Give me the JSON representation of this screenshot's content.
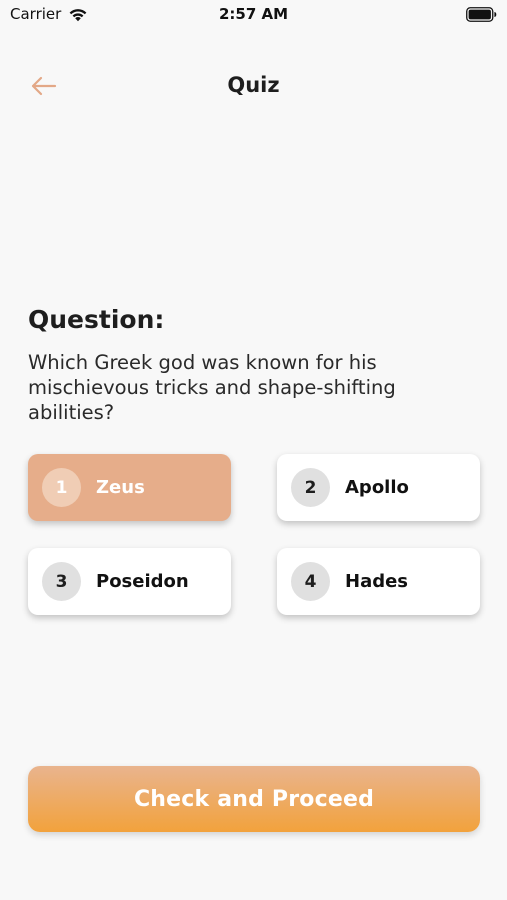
{
  "status_bar": {
    "carrier": "Carrier",
    "time": "2:57 AM",
    "wifi_icon": "wifi-icon",
    "battery_icon": "battery-icon"
  },
  "header": {
    "title": "Quiz",
    "back_icon": "arrow-left-icon",
    "accent_color": "#e3a887"
  },
  "question": {
    "heading": "Question:",
    "text": "Which Greek god was known for his mischievous tricks and shape-shifting abilities?"
  },
  "options": [
    {
      "number": "1",
      "label": "Zeus",
      "selected": true
    },
    {
      "number": "2",
      "label": "Apollo",
      "selected": false
    },
    {
      "number": "3",
      "label": "Poseidon",
      "selected": false
    },
    {
      "number": "4",
      "label": "Hades",
      "selected": false
    }
  ],
  "proceed_button": {
    "label": "Check and Proceed"
  },
  "colors": {
    "background": "#f8f8f8",
    "selected_option": "#e6ad8a",
    "button_gradient_top": "#e9b48e",
    "button_gradient_bottom": "#f2a23c"
  }
}
